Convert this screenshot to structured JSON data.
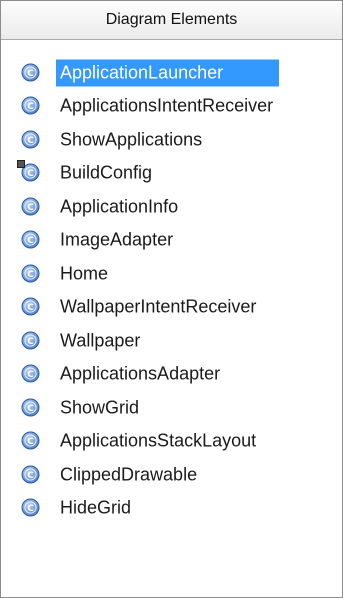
{
  "header": {
    "title": "Diagram Elements"
  },
  "items": [
    {
      "label": "ApplicationLauncher",
      "selected": true
    },
    {
      "label": "ApplicationsIntentReceiver"
    },
    {
      "label": "ShowApplications"
    },
    {
      "label": "BuildConfig",
      "marked": true
    },
    {
      "label": "ApplicationInfo"
    },
    {
      "label": "ImageAdapter"
    },
    {
      "label": "Home"
    },
    {
      "label": "WallpaperIntentReceiver"
    },
    {
      "label": "Wallpaper"
    },
    {
      "label": "ApplicationsAdapter"
    },
    {
      "label": "ShowGrid"
    },
    {
      "label": "ApplicationsStackLayout"
    },
    {
      "label": "ClippedDrawable"
    },
    {
      "label": "HideGrid"
    }
  ],
  "icon": {
    "glyph": "C",
    "fill": "#4e7ec8",
    "ring": "#2a5aa8"
  },
  "selection_color": "#3399ff"
}
